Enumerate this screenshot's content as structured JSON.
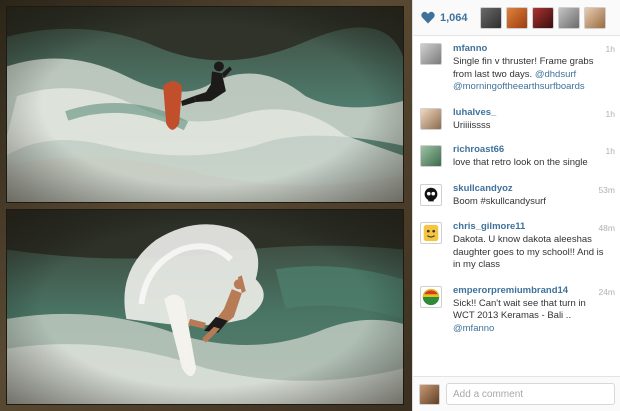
{
  "likes": {
    "count": "1,064",
    "heart_color": "#3f729b"
  },
  "likers": [
    {
      "name": "liker-1",
      "color": "#4a4a4a"
    },
    {
      "name": "liker-2",
      "color": "#c2571e"
    },
    {
      "name": "liker-3",
      "color": "#7a1d1d"
    },
    {
      "name": "liker-4",
      "color": "#8a8a8a"
    },
    {
      "name": "liker-5",
      "color": "#b98a5a"
    }
  ],
  "caption": {
    "user": "mfanno",
    "time": "1h",
    "text": "Single fin v thruster! Frame grabs from last two days. ",
    "mentions": "@dhdsurf @morningoftheearthsurfboards"
  },
  "comments": [
    {
      "user": "luhalves_",
      "time": "1h",
      "text": "Uriiiissss"
    },
    {
      "user": "richroast66",
      "time": "1h",
      "text": "love that retro look on the single"
    },
    {
      "user": "skullcandyoz",
      "time": "53m",
      "text": "Boom #skullcandysurf"
    },
    {
      "user": "chris_gilmore11",
      "time": "48m",
      "text": "Dakota. U know dakota aleeshas daughter goes to my school!! And is in my class"
    },
    {
      "user": "emperorpremiumbrand14",
      "time": "24m",
      "text": "Sick!! Can't wait see that turn in WCT 2013 Keramas - Bali .. ",
      "mention": "@mfanno"
    }
  ],
  "add_comment": {
    "placeholder": "Add a comment"
  },
  "colors": {
    "link": "#3f729b",
    "time": "#b0b0b0"
  }
}
